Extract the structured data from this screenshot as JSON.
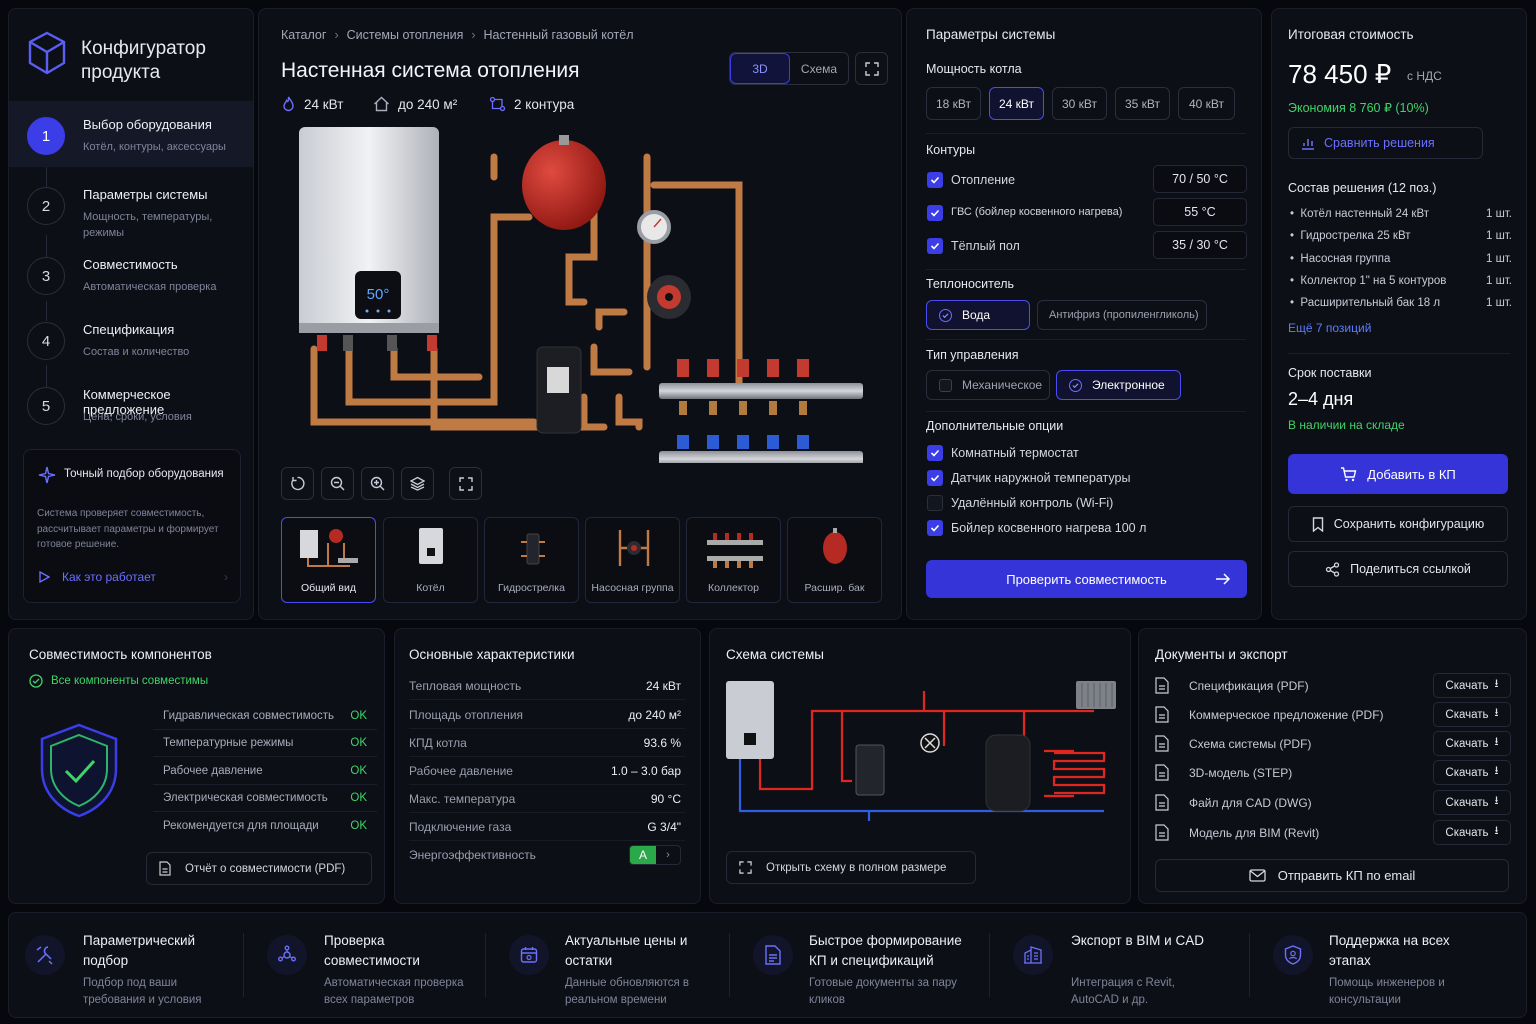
{
  "app": {
    "title": "Конфигуратор продукта"
  },
  "steps": [
    {
      "num": "1",
      "title": "Выбор оборудования",
      "sub": "Котёл, контуры, аксессуары"
    },
    {
      "num": "2",
      "title": "Параметры системы",
      "sub": "Мощность, температуры, режимы"
    },
    {
      "num": "3",
      "title": "Совместимость",
      "sub": "Автоматическая проверка"
    },
    {
      "num": "4",
      "title": "Спецификация",
      "sub": "Состав и количество"
    },
    {
      "num": "5",
      "title": "Коммерческое предложение",
      "sub": "Цена, сроки, условия"
    }
  ],
  "info_card": {
    "title": "Точный подбор оборудования",
    "text": "Система проверяет совместимость, рассчитывает параметры и формирует готовое решение.",
    "link": "Как это работает"
  },
  "viewer": {
    "breadcrumbs": [
      "Каталог",
      "Системы отопления",
      "Настенный газовый котёл"
    ],
    "title": "Настенная система отопления",
    "badges": {
      "power": "24 кВт",
      "area": "до 240 м²",
      "circuits": "2 контура"
    },
    "view_toggle": {
      "a": "3D",
      "b": "Схема"
    },
    "boiler_display": "50°",
    "thumbs": [
      "Общий вид",
      "Котёл",
      "Гидрострелка",
      "Насосная группа",
      "Коллектор",
      "Расшир. бак"
    ]
  },
  "params": {
    "title": "Параметры системы",
    "power_label": "Мощность котла",
    "power_options": [
      "18 кВт",
      "24 кВт",
      "30 кВт",
      "35 кВт",
      "40 кВт"
    ],
    "circuits_label": "Контуры",
    "circuits": [
      {
        "label": "Отопление",
        "value": "70 / 50 °C"
      },
      {
        "label": "ГВС (бойлер косвенного нагрева)",
        "value": "55 °C"
      },
      {
        "label": "Тёплый пол",
        "value": "35 / 30 °C"
      }
    ],
    "coolant_label": "Теплоноситель",
    "coolant": [
      "Вода",
      "Антифриз (пропиленгликоль)"
    ],
    "control_label": "Тип управления",
    "control": [
      "Механическое",
      "Электронное"
    ],
    "options_label": "Дополнительные опции",
    "options": [
      "Комнатный термостат",
      "Датчик наружной температуры",
      "Удалённый контроль (Wi-Fi)",
      "Бойлер косвенного нагрева 100 л"
    ],
    "check_btn": "Проверить совместимость"
  },
  "price": {
    "title": "Итоговая стоимость",
    "amount": "78 450 ₽",
    "vat": "с НДС",
    "saving": "Экономия 8 760 ₽ (10%)",
    "compare": "Сравнить решения",
    "composition_title": "Состав решения (12 поз.)",
    "items": [
      {
        "name": "Котёл настенный 24 кВт",
        "qty": "1 шт."
      },
      {
        "name": "Гидрострелка 25 кВт",
        "qty": "1 шт."
      },
      {
        "name": "Насосная группа",
        "qty": "1 шт."
      },
      {
        "name": "Коллектор 1\" на 5 контуров",
        "qty": "1 шт."
      },
      {
        "name": "Расширительный бак 18 л",
        "qty": "1 шт."
      }
    ],
    "more": "Ещё 7 позиций",
    "delivery_label": "Срок поставки",
    "delivery_value": "2–4 дня",
    "stock": "В наличии на складе",
    "add_btn": "Добавить в КП",
    "save_btn": "Сохранить конфигурацию",
    "share_btn": "Поделиться ссылкой"
  },
  "compat": {
    "title": "Совместимость компонентов",
    "status": "Все компоненты совместимы",
    "checks": [
      {
        "label": "Гидравлическая совместимость",
        "value": "OK"
      },
      {
        "label": "Температурные режимы",
        "value": "OK"
      },
      {
        "label": "Рабочее давление",
        "value": "OK"
      },
      {
        "label": "Электрическая совместимость",
        "value": "OK"
      },
      {
        "label": "Рекомендуется для площади",
        "value": "OK"
      }
    ],
    "report": "Отчёт о совместимости (PDF)"
  },
  "specs": {
    "title": "Основные характеристики",
    "rows": [
      {
        "k": "Тепловая мощность",
        "v": "24 кВт"
      },
      {
        "k": "Площадь отопления",
        "v": "до 240 м²"
      },
      {
        "k": "КПД котла",
        "v": "93.6 %"
      },
      {
        "k": "Рабочее давление",
        "v": "1.0 – 3.0 бар"
      },
      {
        "k": "Макс. температура",
        "v": "90 °C"
      },
      {
        "k": "Подключение газа",
        "v": "G 3/4\""
      }
    ],
    "energy_label": "Энергоэффективность",
    "energy_class": "A"
  },
  "schema": {
    "title": "Схема системы",
    "open": "Открыть схему в полном размере"
  },
  "docs": {
    "title": "Документы и экспорт",
    "download": "Скачать",
    "items": [
      "Спецификация (PDF)",
      "Коммерческое предложение (PDF)",
      "Схема системы (PDF)",
      "3D-модель (STEP)",
      "Файл для CAD (DWG)",
      "Модель для BIM (Revit)"
    ],
    "email": "Отправить КП по email"
  },
  "features": [
    {
      "title": "Параметрический подбор",
      "sub": "Подбор под ваши требования и условия"
    },
    {
      "title": "Проверка совместимости",
      "sub": "Автоматическая проверка всех параметров"
    },
    {
      "title": "Актуальные цены и остатки",
      "sub": "Данные обновляются в реальном времени"
    },
    {
      "title": "Быстрое формирование КП и спецификаций",
      "sub": "Готовые документы за пару кликов"
    },
    {
      "title": "Экспорт в BIM и CAD",
      "sub": "Интеграция с Revit, AutoCAD и др."
    },
    {
      "title": "Поддержка на всех этапах",
      "sub": "Помощь инженеров и консультации"
    }
  ]
}
